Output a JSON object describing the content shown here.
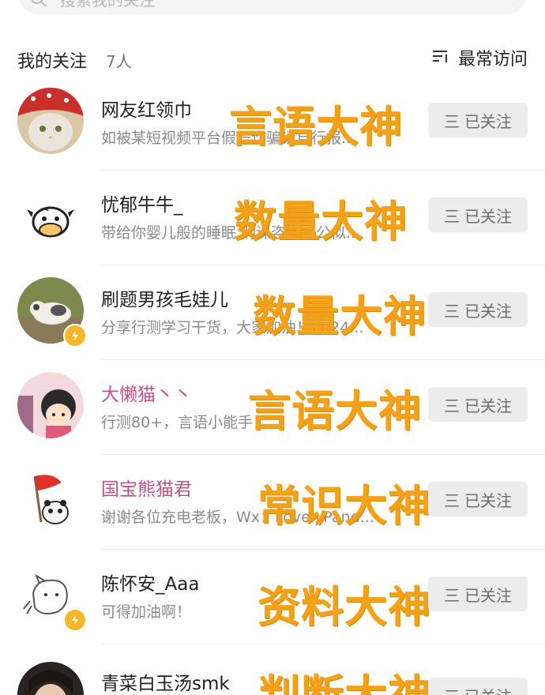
{
  "search": {
    "placeholder": "搜索我的关注"
  },
  "header": {
    "title": "我的关注",
    "count": "7人",
    "sort_label": "最常访问"
  },
  "follow_button": {
    "label": "已关注",
    "glyph": "三"
  },
  "accent_color": "#f4a11a",
  "items": [
    {
      "name": "网友红领巾",
      "desc": "如被某短视频平台假号诈骗请自行报...",
      "tag": "言语大神",
      "verified": false,
      "pink": false
    },
    {
      "name": "忧郁牛牛_",
      "desc": "带给你婴儿般的睡眠 购课咨询：公似...",
      "tag": "数量大神",
      "verified": false,
      "pink": false
    },
    {
      "name": "刷题男孩毛娃儿",
      "desc": "分享行测学习干货，大家加油！2024...",
      "tag": "数量大神",
      "verified": true,
      "pink": false
    },
    {
      "name": "大懒猫丶丶",
      "desc": "行测80+，言语小能手",
      "tag": "言语大神",
      "verified": false,
      "pink": true
    },
    {
      "name": "国宝熊猫君",
      "desc": "谢谢各位充电老板，Wx：LovelyPand...",
      "tag": "常识大神",
      "verified": false,
      "pink": true
    },
    {
      "name": "陈怀安_Aaa",
      "desc": "可得加油啊！",
      "tag": "资料大神",
      "verified": true,
      "pink": false
    },
    {
      "name": "青菜白玉汤smk",
      "desc": "",
      "tag": "判断大神",
      "verified": false,
      "pink": false
    }
  ]
}
